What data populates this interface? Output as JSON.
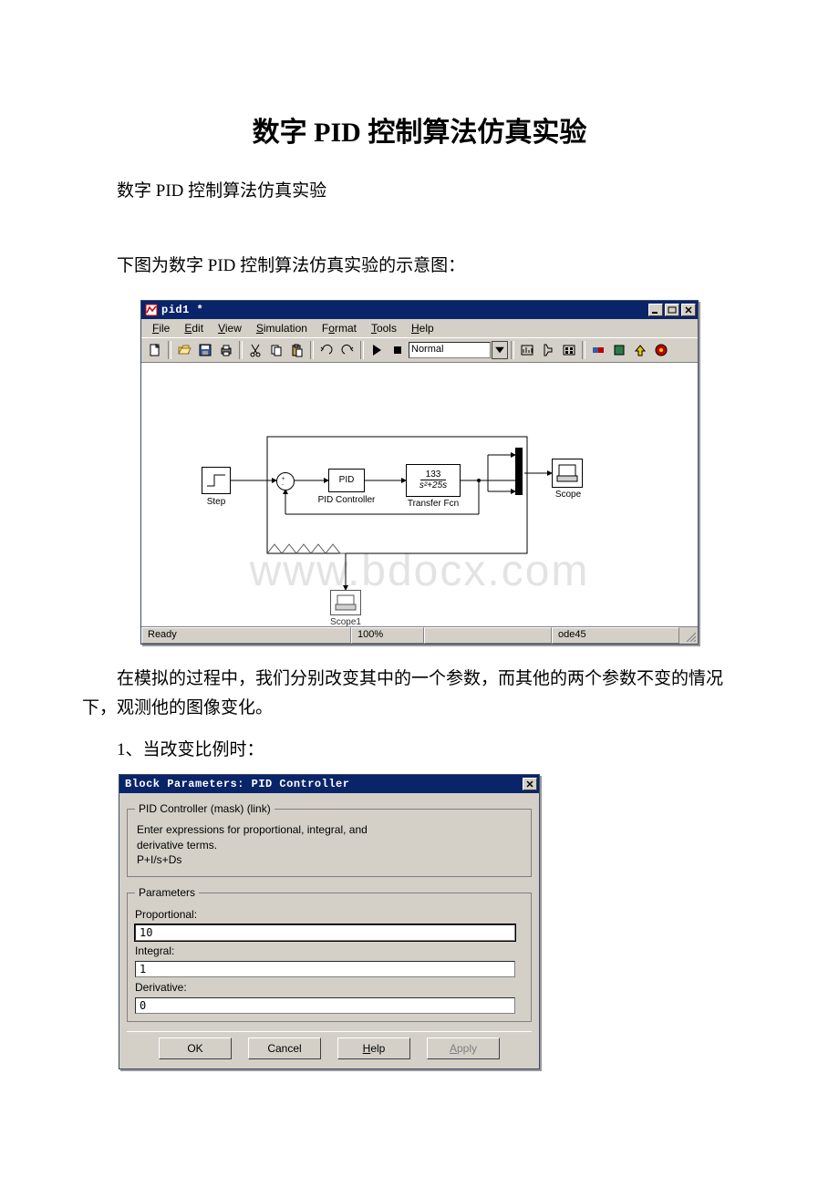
{
  "doc": {
    "title": "数字 PID 控制算法仿真实验",
    "subtitle": "数字 PID 控制算法仿真实验",
    "intro": "下图为数字 PID 控制算法仿真实验的示意图：",
    "after_fig": "在模拟的过程中，我们分别改变其中的一个参数，而其他的两个参数不变的情况下，观测他的图像变化。",
    "item1": "1、当改变比例时："
  },
  "simwin": {
    "title": "pid1 *",
    "menu": [
      "File",
      "Edit",
      "View",
      "Simulation",
      "Format",
      "Tools",
      "Help"
    ],
    "mode": "Normal",
    "status_ready": "Ready",
    "status_zoom": "100%",
    "status_solver": "ode45",
    "blocks": {
      "step": "Step",
      "pid": "PID",
      "pid_label": "PID Controller",
      "tf_num": "133",
      "tf_den": "s²+25s",
      "tf_label": "Transfer Fcn",
      "scope": "Scope",
      "scope1": "Scope1"
    }
  },
  "dlg": {
    "title": "Block Parameters: PID Controller",
    "legend1": "PID Controller (mask) (link)",
    "desc": "Enter expressions for proportional, integral, and derivative terms.\nP+I/s+Ds",
    "legend2": "Parameters",
    "p_label": "Proportional:",
    "p_val": "10",
    "i_label": "Integral:",
    "i_val": "1",
    "d_label": "Derivative:",
    "d_val": "0",
    "ok": "OK",
    "cancel": "Cancel",
    "help": "Help",
    "apply": "Apply"
  },
  "watermark": "www.bdocx.com"
}
